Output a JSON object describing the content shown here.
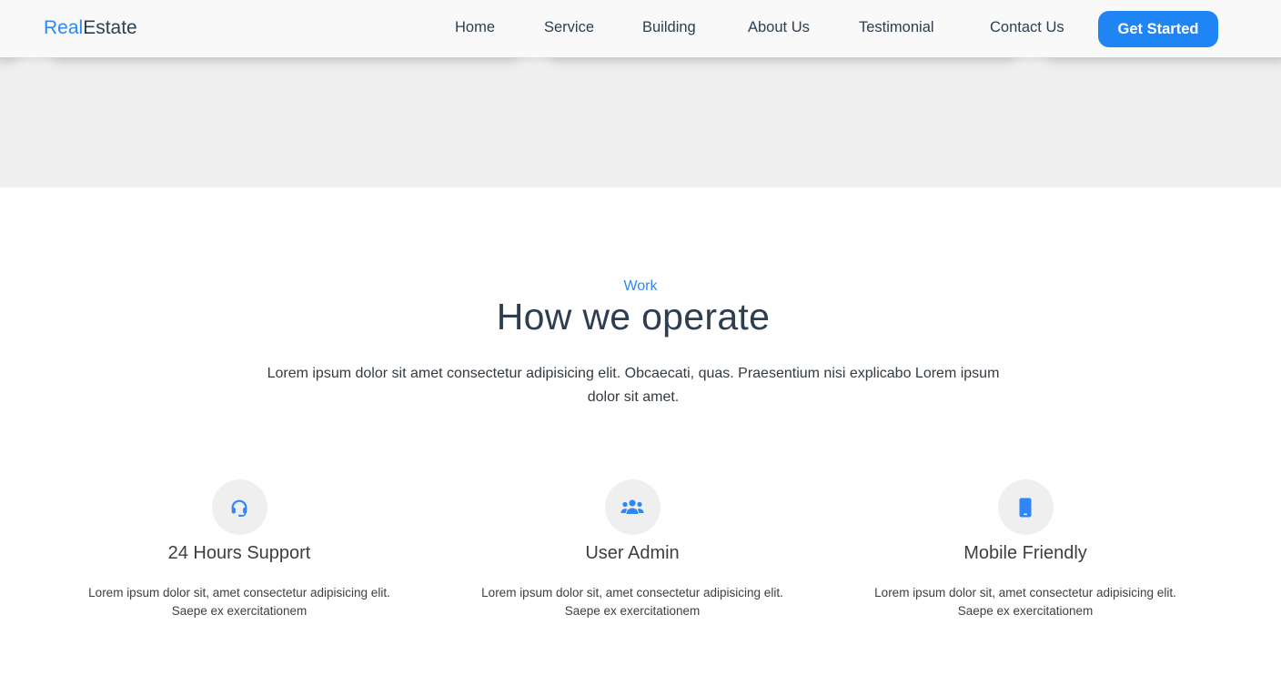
{
  "brand": {
    "accent": "Real",
    "rest": "Estate"
  },
  "nav": {
    "links": [
      "Home",
      "Service",
      "Building",
      "About Us",
      "Testimonial",
      "Contact Us"
    ],
    "cta": "Get Started"
  },
  "section": {
    "eyebrow": "Work",
    "title": "How we operate",
    "lead": "Lorem ipsum dolor sit amet consectetur adipisicing elit. Obcaecati, quas. Praesentium nisi explicabo Lorem ipsum dolor sit amet."
  },
  "features": [
    {
      "icon": "headset-icon",
      "title": "24 Hours Support",
      "desc": "Lorem ipsum dolor sit, amet consectetur adipisicing elit. Saepe ex exercitationem"
    },
    {
      "icon": "users-icon",
      "title": "User Admin",
      "desc": "Lorem ipsum dolor sit, amet consectetur adipisicing elit. Saepe ex exercitationem"
    },
    {
      "icon": "mobile-icon",
      "title": "Mobile Friendly",
      "desc": "Lorem ipsum dolor sit, amet consectetur adipisicing elit. Saepe ex exercitationem"
    }
  ],
  "colors": {
    "accent": "#2f86f6",
    "button": "#1f85f5",
    "heading": "#2c3e50",
    "band": "#efefef"
  }
}
